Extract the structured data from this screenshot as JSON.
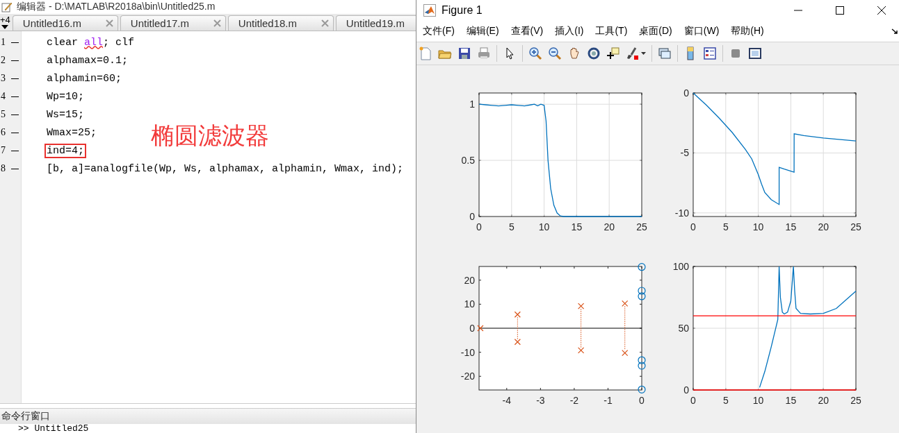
{
  "editor": {
    "title": "编辑器 - D:\\MATLAB\\R2018a\\bin\\Untitled25.m",
    "more_tabs": "+4",
    "tabs": [
      {
        "label": "Untitled16.m",
        "selected": false,
        "closable": true
      },
      {
        "label": "Untitled17.m",
        "selected": false,
        "closable": true
      },
      {
        "label": "Untitled18.m",
        "selected": false,
        "closable": true
      },
      {
        "label": "Untitled19.m",
        "selected": false,
        "closable": false
      }
    ],
    "lines": [
      {
        "number": "1",
        "highlighted": false,
        "segments": [
          {
            "text": "clear ",
            "kind": "plain"
          },
          {
            "text": "all",
            "kind": "warning"
          },
          {
            "text": "; clf",
            "kind": "plain"
          }
        ]
      },
      {
        "number": "2",
        "highlighted": false,
        "segments": [
          {
            "text": "alphamax=0.1;",
            "kind": "plain"
          }
        ]
      },
      {
        "number": "3",
        "highlighted": false,
        "segments": [
          {
            "text": "alphamin=60;",
            "kind": "plain"
          }
        ]
      },
      {
        "number": "4",
        "highlighted": false,
        "segments": [
          {
            "text": "Wp=10;",
            "kind": "plain"
          }
        ]
      },
      {
        "number": "5",
        "highlighted": false,
        "segments": [
          {
            "text": "Ws=15;",
            "kind": "plain"
          }
        ]
      },
      {
        "number": "6",
        "highlighted": false,
        "segments": [
          {
            "text": "Wmax=25;",
            "kind": "plain"
          }
        ]
      },
      {
        "number": "7",
        "highlighted": true,
        "segments": [
          {
            "text": "ind=4;",
            "kind": "plain"
          }
        ]
      },
      {
        "number": "8",
        "highlighted": false,
        "segments": [
          {
            "text": "[b, a]=analogfile(Wp, Ws, alphamax, alphamin, Wmax, ind);",
            "kind": "plain"
          }
        ]
      }
    ],
    "annotation": "椭圆滤波器",
    "command_window": {
      "title": "命令行窗口",
      "text": ">> Untitled25"
    }
  },
  "figure": {
    "title": "Figure 1",
    "menu": [
      "文件(F)",
      "编辑(E)",
      "查看(V)",
      "插入(I)",
      "工具(T)",
      "桌面(D)",
      "窗口(W)",
      "帮助(H)"
    ],
    "plots": [
      {
        "chart_data": {
          "type": "line",
          "grid": true,
          "x": [
            0,
            1,
            2,
            3,
            4,
            5,
            6,
            7,
            8,
            8.5,
            9,
            9.5,
            10,
            10.3,
            10.6,
            11,
            11.5,
            12,
            12.5,
            13,
            14,
            15,
            20,
            25
          ],
          "series": [
            {
              "color": "#0072bd",
              "values": [
                1,
                0.995,
                0.99,
                0.985,
                0.99,
                0.995,
                0.99,
                0.985,
                0.995,
                1,
                0.985,
                1,
                0.99,
                0.85,
                0.5,
                0.25,
                0.1,
                0.03,
                0.005,
                0,
                0,
                0,
                0,
                0
              ]
            }
          ],
          "xlim": [
            0,
            25
          ],
          "ylim": [
            0,
            1.1
          ],
          "xticks": [
            0,
            5,
            10,
            15,
            20,
            25
          ],
          "yticks": [
            0,
            0.5,
            1
          ]
        }
      },
      {
        "chart_data": {
          "type": "line",
          "grid": true,
          "x": [
            0,
            2,
            4,
            6,
            8,
            9,
            10,
            10.5,
            11,
            12,
            13.2,
            13.21,
            14,
            15.5,
            15.51,
            17,
            20,
            25
          ],
          "series": [
            {
              "color": "#0072bd",
              "values": [
                0,
                -1,
                -2.1,
                -3.3,
                -4.7,
                -5.5,
                -6.8,
                -7.6,
                -8.3,
                -8.9,
                -9.3,
                -6.2,
                -6.35,
                -6.6,
                -3.4,
                -3.55,
                -3.75,
                -4.0
              ]
            }
          ],
          "xlim": [
            0,
            25
          ],
          "ylim": [
            -10.3,
            0
          ],
          "xticks": [
            0,
            5,
            10,
            15,
            20,
            25
          ],
          "yticks": [
            -10,
            -5,
            0
          ]
        }
      },
      {
        "chart_data": {
          "type": "scatter",
          "series": [
            {
              "color": "#d95319",
              "x": [
                -4.78,
                -3.68,
                -3.68,
                -1.8,
                -1.8,
                -0.5,
                -0.5
              ],
              "values": [
                0,
                5.7,
                -5.7,
                9.2,
                -9.2,
                10.3,
                -10.3
              ]
            },
            {
              "color": "#0072bd",
              "x": [
                0,
                0,
                0,
                0,
                0,
                0
              ],
              "values": [
                25.5,
                15.6,
                13.3,
                -13.3,
                -15.6,
                -25.5
              ]
            }
          ],
          "xlim": [
            -4.82,
            0
          ],
          "ylim": [
            -25.7,
            25.7
          ],
          "xticks": [
            -4,
            -3,
            -2,
            -1,
            0
          ],
          "yticks": [
            -20,
            -10,
            0,
            10,
            20
          ]
        }
      },
      {
        "chart_data": {
          "type": "line",
          "grid": true,
          "x": [
            0,
            10,
            10.2,
            11,
            12,
            13,
            13.2,
            13.4,
            13.7,
            14,
            14.5,
            15,
            15.4,
            15.6,
            15.8,
            16.5,
            18,
            20,
            22,
            25
          ],
          "series": [
            {
              "color": "#0072bd",
              "values": [
                null,
                null,
                2,
                15,
                35,
                57,
                100,
                75,
                63,
                61.5,
                63,
                72,
                100,
                80,
                66,
                62,
                61.5,
                62,
                66,
                80
              ]
            },
            {
              "color": "#ff0000",
              "values": [
                60,
                60,
                60,
                60,
                60,
                60,
                60,
                60,
                60,
                60,
                60,
                60,
                60,
                60,
                60,
                60,
                60,
                60,
                60,
                60
              ]
            },
            {
              "color": "#ff0000",
              "values": [
                0,
                0,
                0,
                0,
                0,
                0,
                0,
                0,
                0,
                0,
                0,
                0,
                0,
                0,
                0,
                0,
                0,
                0,
                0,
                0
              ]
            }
          ],
          "xlim": [
            0,
            25
          ],
          "ylim": [
            0,
            100
          ],
          "xticks": [
            0,
            5,
            10,
            15,
            20,
            25
          ],
          "yticks": [
            0,
            50,
            100
          ]
        }
      }
    ]
  }
}
